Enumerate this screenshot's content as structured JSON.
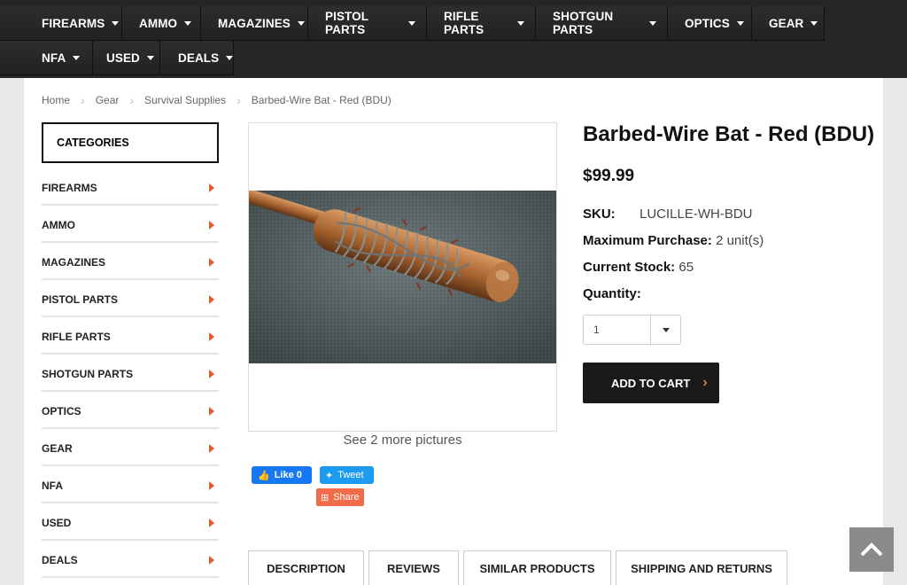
{
  "nav": {
    "row1": [
      "FIREARMS",
      "AMMO",
      "MAGAZINES",
      "PISTOL PARTS",
      "RIFLE PARTS",
      "SHOTGUN PARTS",
      "OPTICS",
      "GEAR"
    ],
    "row2": [
      "NFA",
      "USED",
      "DEALS"
    ]
  },
  "breadcrumb": [
    "Home",
    "Gear",
    "Survival Supplies",
    "Barbed-Wire Bat - Red (BDU)"
  ],
  "sidebar": {
    "heading": "CATEGORIES",
    "items": [
      "FIREARMS",
      "AMMO",
      "MAGAZINES",
      "PISTOL PARTS",
      "RIFLE PARTS",
      "SHOTGUN PARTS",
      "OPTICS",
      "GEAR",
      "NFA",
      "USED",
      "DEALS"
    ]
  },
  "gallery": {
    "more_pictures": "See 2 more pictures"
  },
  "social": {
    "like": "Like 0",
    "tweet": "Tweet",
    "share": "Share"
  },
  "product": {
    "title": "Barbed-Wire Bat - Red (BDU)",
    "price": "$99.99",
    "sku_label": "SKU:",
    "sku_value": "LUCILLE-WH-BDU",
    "max_label": "Maximum Purchase:",
    "max_value": "2 unit(s)",
    "stock_label": "Current Stock:",
    "stock_value": "65",
    "qty_label": "Quantity:",
    "qty_value": "1",
    "add_to_cart": "ADD TO CART"
  },
  "tabs": [
    "DESCRIPTION",
    "REVIEWS",
    "SIMILAR PRODUCTS",
    "SHIPPING AND RETURNS"
  ],
  "colors": {
    "nav_bg": "#262626",
    "accent": "#e25a2a",
    "cart_bg": "#1a1a1a"
  }
}
